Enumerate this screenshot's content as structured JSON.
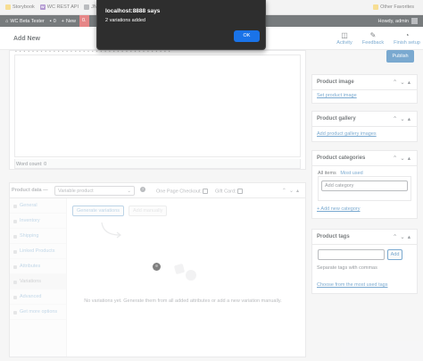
{
  "bookmarks": {
    "items": [
      {
        "label": "Storybook",
        "icon": "folder-icon"
      },
      {
        "label": "WC REST API",
        "icon": "woocommerce-icon"
      },
      {
        "label": "JN",
        "icon": "folder-icon"
      }
    ],
    "other": "Other Favorites"
  },
  "admin_bar": {
    "site": "WC Beta Tester",
    "comments": "0",
    "new": "New",
    "badge": "0.",
    "howdy": "Howdy, admin"
  },
  "header": {
    "title": "Add New",
    "activity": "Activity",
    "feedback": "Feedback",
    "finish_setup": "Finish setup"
  },
  "editor": {
    "word_count": "Word count: 0"
  },
  "publish": {
    "label": "Publish"
  },
  "product_data": {
    "label": "Product data —",
    "type_select": "Variable product",
    "one_page_checkout": "One Page Checkout:",
    "gift_card": "Gift Card:",
    "tabs": [
      "General",
      "Inventory",
      "Shipping",
      "Linked Products",
      "Attributes",
      "Variations",
      "Advanced",
      "Get more options"
    ],
    "active_tab": "Variations",
    "generate_btn": "Generate variations",
    "add_manually_btn": "Add manually",
    "empty_message": "No variations yet. Generate them from all added attributes or add a new variation manually."
  },
  "sidebar": {
    "product_image": {
      "title": "Product image",
      "link": "Set product image"
    },
    "product_gallery": {
      "title": "Product gallery",
      "link": "Add product gallery images"
    },
    "product_categories": {
      "title": "Product categories",
      "tab_all": "All items",
      "tab_used": "Most used",
      "input_value": "Add category",
      "add_link": "+ Add new category"
    },
    "product_tags": {
      "title": "Product tags",
      "add_btn": "Add",
      "hint": "Separate tags with commas",
      "choose_link": "Choose from the most used tags"
    }
  },
  "dialog": {
    "title": "localhost:8888 says",
    "message": "2 variations added",
    "ok": "OK"
  },
  "colors": {
    "accent": "#2271b1",
    "admin_bar": "#1d2327",
    "dialog_bg": "#2e2e2e",
    "ok_button": "#1a73e8"
  }
}
